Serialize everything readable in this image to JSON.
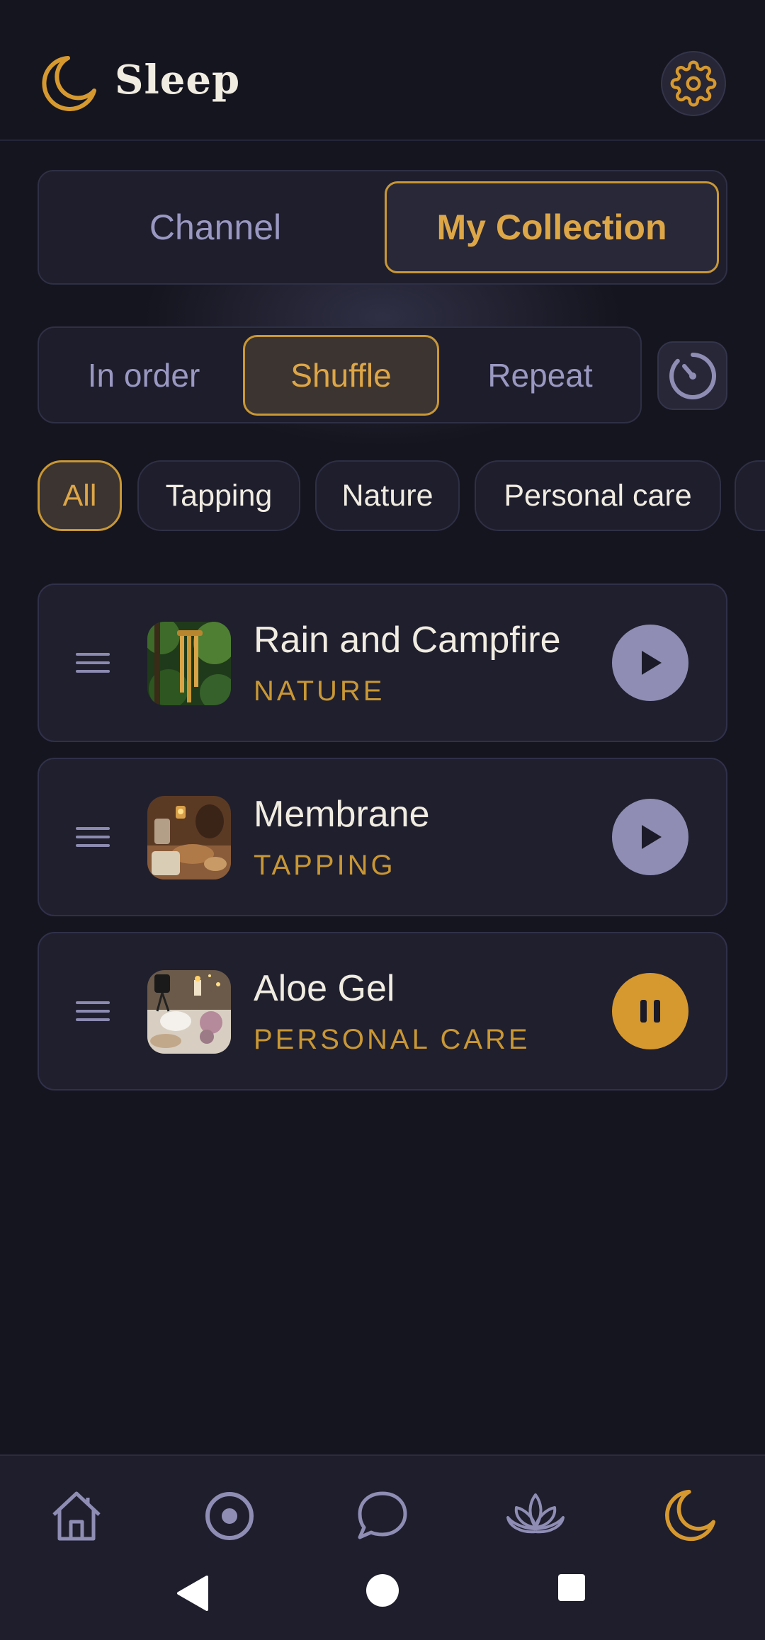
{
  "header": {
    "title": "Sleep",
    "logo_icon": "moon-icon",
    "settings_icon": "gear-icon"
  },
  "tabs": [
    {
      "label": "Channel",
      "active": false
    },
    {
      "label": "My Collection",
      "active": true
    }
  ],
  "play_modes": [
    {
      "label": "In order",
      "active": false
    },
    {
      "label": "Shuffle",
      "active": true
    },
    {
      "label": "Repeat",
      "active": false
    }
  ],
  "timer_icon": "timer-icon",
  "categories": [
    {
      "label": "All",
      "active": true
    },
    {
      "label": "Tapping",
      "active": false
    },
    {
      "label": "Nature",
      "active": false
    },
    {
      "label": "Personal care",
      "active": false
    }
  ],
  "tracks": [
    {
      "title": "Rain and Campfire",
      "category": "NATURE",
      "state": "play"
    },
    {
      "title": "Membrane",
      "category": "TAPPING",
      "state": "play"
    },
    {
      "title": "Aloe Gel",
      "category": "PERSONAL CARE",
      "state": "pause"
    }
  ],
  "bottom_nav": [
    {
      "icon": "home-icon",
      "active": false
    },
    {
      "icon": "target-icon",
      "active": false
    },
    {
      "icon": "chat-icon",
      "active": false
    },
    {
      "icon": "lotus-icon",
      "active": false
    },
    {
      "icon": "moon-icon",
      "active": true
    }
  ],
  "system_nav": [
    "back-icon",
    "home-circle-icon",
    "recents-icon"
  ],
  "colors": {
    "background": "#15151f",
    "accent": "#d6992f",
    "muted": "#9a98c2",
    "text": "#f1ece1"
  }
}
